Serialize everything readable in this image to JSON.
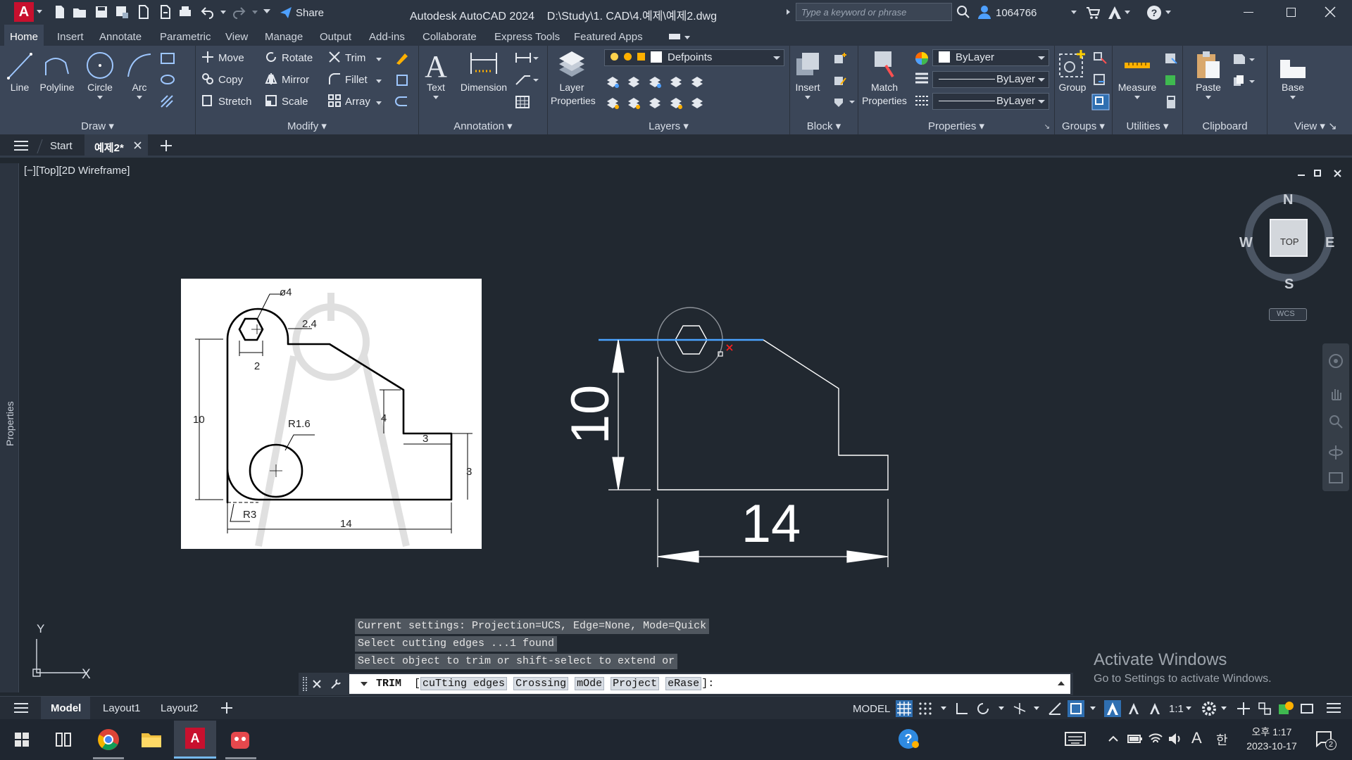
{
  "titlebar": {
    "app_title": "Autodesk AutoCAD 2024",
    "file_path": "D:\\Study\\1. CAD\\4.예제\\예제2.dwg",
    "share_label": "Share",
    "search_placeholder": "Type a keyword or phrase",
    "user_id": "1064766"
  },
  "ribbon_tabs": [
    "Home",
    "Insert",
    "Annotate",
    "Parametric",
    "View",
    "Manage",
    "Output",
    "Add-ins",
    "Collaborate",
    "Express Tools",
    "Featured Apps"
  ],
  "ribbon": {
    "draw": {
      "label": "Draw",
      "line": "Line",
      "polyline": "Polyline",
      "circle": "Circle",
      "arc": "Arc"
    },
    "modify": {
      "label": "Modify",
      "move": "Move",
      "rotate": "Rotate",
      "trim": "Trim",
      "copy": "Copy",
      "mirror": "Mirror",
      "fillet": "Fillet",
      "stretch": "Stretch",
      "scale": "Scale",
      "array": "Array"
    },
    "annotation": {
      "label": "Annotation",
      "text": "Text",
      "dimension": "Dimension"
    },
    "layers": {
      "label": "Layers",
      "layer_properties_1": "Layer",
      "layer_properties_2": "Properties",
      "current_layer": "Defpoints"
    },
    "block": {
      "label": "Block",
      "insert": "Insert"
    },
    "properties": {
      "label": "Properties",
      "match_1": "Match",
      "match_2": "Properties",
      "color": "ByLayer",
      "linetype": "ByLayer",
      "lineweight": "ByLayer"
    },
    "groups": {
      "label": "Groups",
      "group": "Group"
    },
    "utilities": {
      "label": "Utilities",
      "measure": "Measure"
    },
    "clipboard": {
      "label": "Clipboard",
      "paste": "Paste"
    },
    "view": {
      "label": "View",
      "base": "Base"
    }
  },
  "file_tabs": {
    "start": "Start",
    "active": "예제2*"
  },
  "canvas": {
    "properties_label": "Properties",
    "view_label": "[−][Top][2D Wireframe]",
    "viewcube": {
      "n": "N",
      "s": "S",
      "e": "E",
      "w": "W",
      "top": "TOP",
      "wcs": "WCS"
    },
    "ucs": {
      "x": "X",
      "y": "Y"
    },
    "reference_dims": {
      "hole": "ø4",
      "d24": "2.4",
      "d2": "2",
      "d10": "10",
      "r16": "R1.6",
      "d4": "4",
      "d3a": "3",
      "d3b": "3",
      "r3": "R3",
      "d14": "14"
    },
    "drawing_dims": {
      "vertical": "10",
      "horizontal": "14"
    }
  },
  "command": {
    "history": [
      "Current settings: Projection=UCS, Edge=None, Mode=Quick",
      "Select cutting edges ...1 found",
      "Select object to trim or shift-select to extend or"
    ],
    "prompt_cmd": "TRIM",
    "options": [
      "cuTting edges",
      "Crossing",
      "mOde",
      "Project",
      "eRase"
    ]
  },
  "activation": {
    "title": "Activate Windows",
    "subtitle": "Go to Settings to activate Windows."
  },
  "status": {
    "layout_tabs": [
      "Model",
      "Layout1",
      "Layout2"
    ],
    "model_label": "MODEL",
    "scale": "1:1"
  },
  "taskbar": {
    "time": "오후 1:17",
    "date": "2023-10-17",
    "ime": "한",
    "notif_count": "2"
  }
}
